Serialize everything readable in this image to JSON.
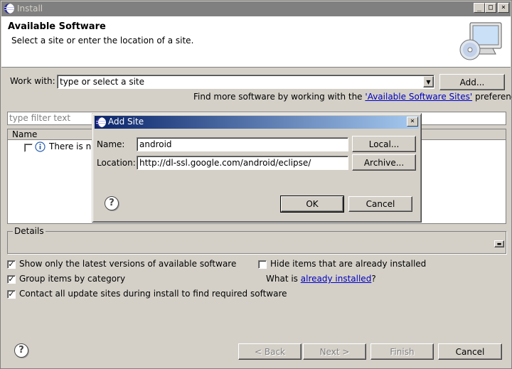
{
  "window": {
    "title": "Install",
    "controls": {
      "minimize": "_",
      "maximize": "□",
      "close": "×"
    }
  },
  "header": {
    "title": "Available Software",
    "subtitle": "Select a site or enter the location of a site."
  },
  "work_with": {
    "label": "Work with:",
    "value": "type or select a site",
    "add_button": "Add...",
    "find_more_prefix": "Find more software by working with the",
    "find_more_link": "'Available Software Sites'",
    "find_more_suffix": "preferences."
  },
  "filter": {
    "placeholder": "type filter text"
  },
  "tree": {
    "column_header": "Name",
    "row_text": "There is no"
  },
  "details": {
    "title": "Details"
  },
  "options": {
    "show_latest": {
      "label": "Show only the latest versions of available software",
      "checked": true
    },
    "group_by_category": {
      "label": "Group items by category",
      "checked": true
    },
    "contact_sites": {
      "label": "Contact all update sites during install to find required software",
      "checked": true
    },
    "hide_installed": {
      "label": "Hide items that are already installed",
      "checked": false
    },
    "what_is_prefix": "What is",
    "what_is_link": "already installed",
    "what_is_suffix": "?"
  },
  "footer": {
    "back": "< Back",
    "next": "Next >",
    "finish": "Finish",
    "cancel": "Cancel"
  },
  "add_site_dialog": {
    "title": "Add Site",
    "close": "×",
    "name_label": "Name:",
    "name_value": "android",
    "location_label": "Location:",
    "location_value": "http://dl-ssl.google.com/android/eclipse/",
    "local_button": "Local...",
    "archive_button": "Archive...",
    "ok_button": "OK",
    "cancel_button": "Cancel"
  },
  "colors": {
    "window_bg": "#d4d0c8",
    "dialog_title_start": "#0a246a",
    "dialog_title_end": "#a6caf0",
    "link": "#0000c0"
  },
  "icons": {
    "app": "eclipse-icon",
    "header": "monitor-cd-icon",
    "help": "help-icon",
    "info": "info-icon"
  }
}
